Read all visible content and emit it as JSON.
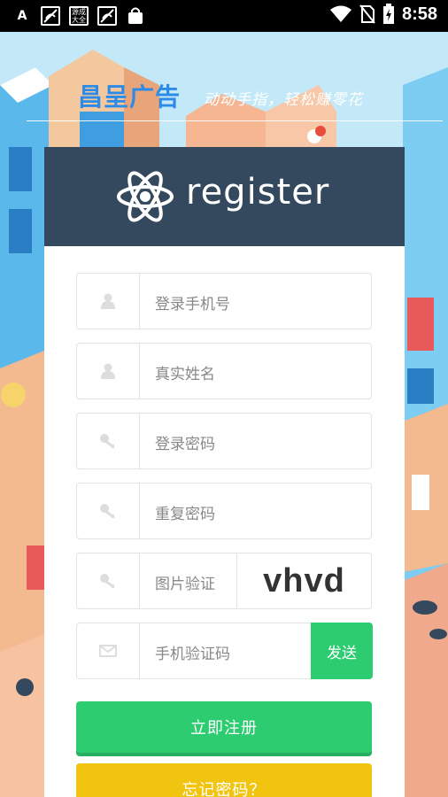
{
  "status_bar": {
    "time": "8:58",
    "app_icons": [
      "A",
      "",
      "源成大全",
      "",
      ""
    ]
  },
  "header": {
    "brand": "昌呈广告",
    "slogan": "动动手指，轻松赚零花"
  },
  "card": {
    "title": "register"
  },
  "form": {
    "phone_placeholder": "登录手机号",
    "name_placeholder": "真实姓名",
    "password_placeholder": "登录密码",
    "repeat_password_placeholder": "重复密码",
    "captcha_placeholder": "图片验证",
    "captcha_image_text": "vhvd",
    "sms_code_placeholder": "手机验证码",
    "send_label": "发送"
  },
  "buttons": {
    "register": "立即注册",
    "forgot_password": "忘记密码？"
  },
  "colors": {
    "brand": "#2c8be8",
    "header_bg": "#34495e",
    "green": "#2ecc71",
    "yellow": "#f1c40f"
  }
}
